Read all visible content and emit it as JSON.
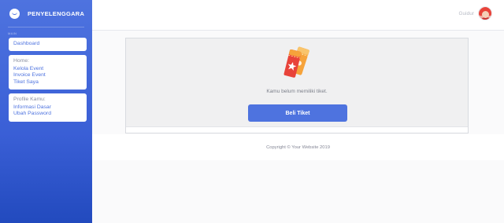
{
  "brand": {
    "name": "PENYELENGGARA",
    "icon": "smile-logo-icon"
  },
  "sidebar": {
    "section_label": "MAIN",
    "dashboard": "Dashboard",
    "home": {
      "title": "Home:",
      "links": [
        "Kelola Event",
        "Invoice Event",
        "Tiket Saya"
      ]
    },
    "profile": {
      "title": "Profile Kamu:",
      "links": [
        "Informasi Dasar",
        "Ubah Password"
      ]
    }
  },
  "topbar": {
    "user_name": "Guidur",
    "avatar_icon": "user-avatar-icon"
  },
  "main": {
    "empty_message": "Kamu belum memiliki tiket.",
    "buy_button": "Beli Tiket",
    "illustration_icon": "tickets-icon"
  },
  "footer": {
    "copyright": "Copyright © Your Website 2019"
  },
  "colors": {
    "primary": "#4e73df",
    "ticket_red": "#e8433a",
    "ticket_orange": "#f6a33b"
  }
}
